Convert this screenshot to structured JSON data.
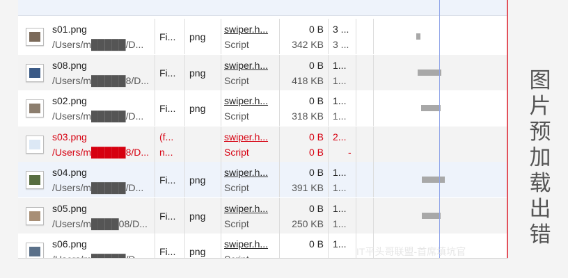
{
  "rows": [
    {
      "name": "s01.png",
      "path": "/Users/m█████/D...",
      "status": "Fi...",
      "type": "png",
      "initiator": "swiper.h...",
      "initiator_type": "Script",
      "size": "0 B",
      "size2": "342 KB",
      "time": "3 ...",
      "time2": "3 ...",
      "error": false
    },
    {
      "name": "s08.png",
      "path": "/Users/m█████8/D...",
      "status": "Fi...",
      "type": "png",
      "initiator": "swiper.h...",
      "initiator_type": "Script",
      "size": "0 B",
      "size2": "418 KB",
      "time": "1...",
      "time2": "1...",
      "error": false
    },
    {
      "name": "s02.png",
      "path": "/Users/m█████/D...",
      "status": "Fi...",
      "type": "png",
      "initiator": "swiper.h...",
      "initiator_type": "Script",
      "size": "0 B",
      "size2": "318 KB",
      "time": "1...",
      "time2": "1...",
      "error": false
    },
    {
      "name": "s03.png",
      "path": "/Users/m█████8/D...",
      "status": "(f...",
      "status2": "n...",
      "type": "",
      "initiator": "swiper.h...",
      "initiator_type": "Script",
      "size": "0 B",
      "size2": "0 B",
      "time": "2...",
      "time2": "-",
      "error": true
    },
    {
      "name": "s04.png",
      "path": "/Users/m█████/D...",
      "status": "Fi...",
      "type": "png",
      "initiator": "swiper.h...",
      "initiator_type": "Script",
      "size": "0 B",
      "size2": "391 KB",
      "time": "1...",
      "time2": "1...",
      "error": false
    },
    {
      "name": "s05.png",
      "path": "/Users/m████08/D...",
      "status": "Fi...",
      "type": "png",
      "initiator": "swiper.h...",
      "initiator_type": "Script",
      "size": "0 B",
      "size2": "250 KB",
      "time": "1...",
      "time2": "1...",
      "error": false
    },
    {
      "name": "s06.png",
      "path": "/Users/m█████/D...",
      "status": "Fi...",
      "type": "png",
      "initiator": "swiper.h...",
      "initiator_type": "Script",
      "size": "0 B",
      "size2": "",
      "time": "1...",
      "time2": "",
      "error": false
    }
  ],
  "side_label": "图片预加载出错",
  "watermark": "IT平头哥联盟-首席填坑官",
  "colors": {
    "error": "#d60010",
    "waterfall_bar": "#a8a8a8",
    "timeline_marker": "#8da2e8",
    "load_marker": "#e2505a"
  }
}
